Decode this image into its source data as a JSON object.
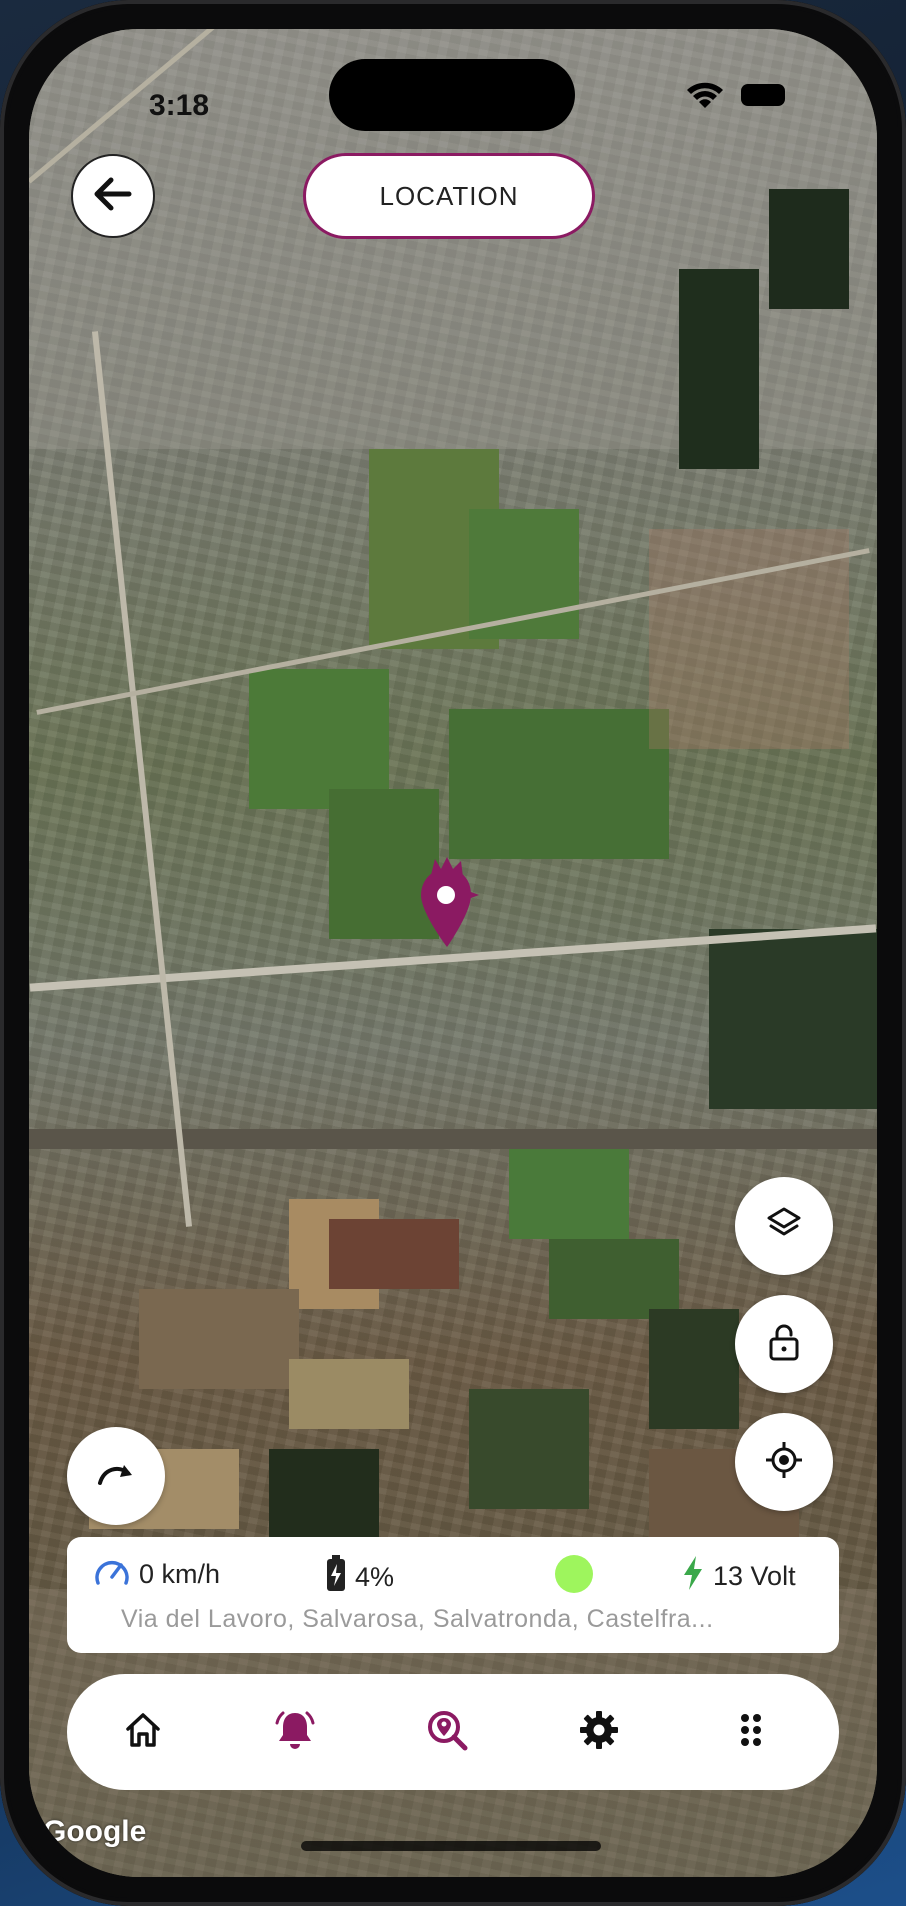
{
  "status_bar": {
    "time": "3:18"
  },
  "header": {
    "title": "LOCATION"
  },
  "info": {
    "speed": "0 km/h",
    "battery": "4%",
    "voltage": "13 Volt",
    "address": "Via del Lavoro, Salvarosa, Salvatronda, Castelfra..."
  },
  "map": {
    "attribution": "Google"
  },
  "icons": {
    "back": "arrow-left-icon",
    "layers": "layers-icon",
    "lock": "lock-open-icon",
    "locate": "crosshair-icon",
    "redo": "redo-arrow-icon",
    "speed": "speedometer-icon",
    "battery": "battery-icon",
    "voltage": "lightning-icon",
    "nav": [
      "home-icon",
      "bell-icon",
      "search-location-icon",
      "gear-icon",
      "grid-dots-icon"
    ]
  },
  "colors": {
    "accent": "#8b1a62",
    "status_dot": "#9ef55d",
    "speed_icon": "#3b73d9",
    "voltage_icon": "#3aa84a"
  }
}
